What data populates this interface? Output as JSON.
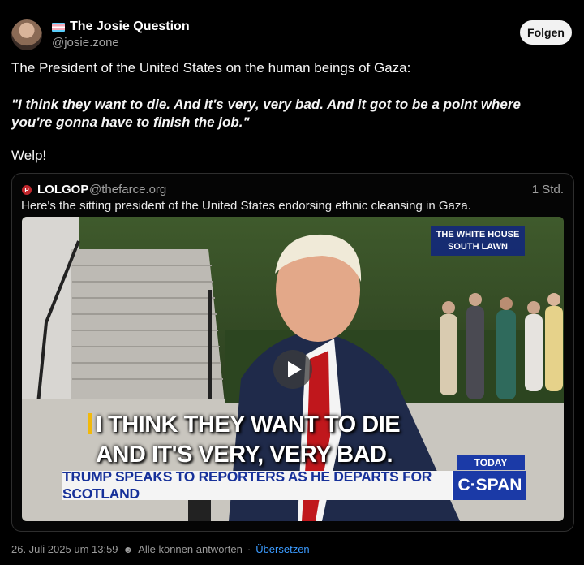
{
  "author": {
    "display_name": "The Josie Question",
    "handle": "@josie.zone",
    "flag_icon": "transgender-flag-icon"
  },
  "follow_label": "Folgen",
  "post": {
    "intro": "The President of the United States on the human beings of Gaza:",
    "quote": "\"I think they want to die. And it's very, very bad. And it got to be a point where you're gonna have to finish the job.\"",
    "closing": "Welp!"
  },
  "quoted_post": {
    "name": "LOLGOP",
    "handle": "@thefarce.org",
    "time": "1 Std.",
    "text": "Here's the sitting president of the United States endorsing ethnic cleansing in Gaza.",
    "avatar_letter": "P",
    "video": {
      "location_badge_line1": "THE WHITE HOUSE",
      "location_badge_line2": "SOUTH LAWN",
      "caption_line1": "I THINK THEY WANT TO DIE",
      "caption_line2": "AND IT'S VERY, VERY BAD.",
      "today_label": "TODAY",
      "chyron": "TRUMP SPEAKS TO REPORTERS AS HE DEPARTS FOR SCOTLAND",
      "network": "C·SPAN",
      "play_icon": "play-icon"
    }
  },
  "footer": {
    "timestamp": "26. Juli 2025 um 13:59",
    "reply_setting": "Alle können antworten",
    "separator": "·",
    "translate_label": "Übersetzen"
  },
  "colors": {
    "background": "#000000",
    "link": "#3b9bff",
    "network_blue": "#1b3aa7"
  }
}
